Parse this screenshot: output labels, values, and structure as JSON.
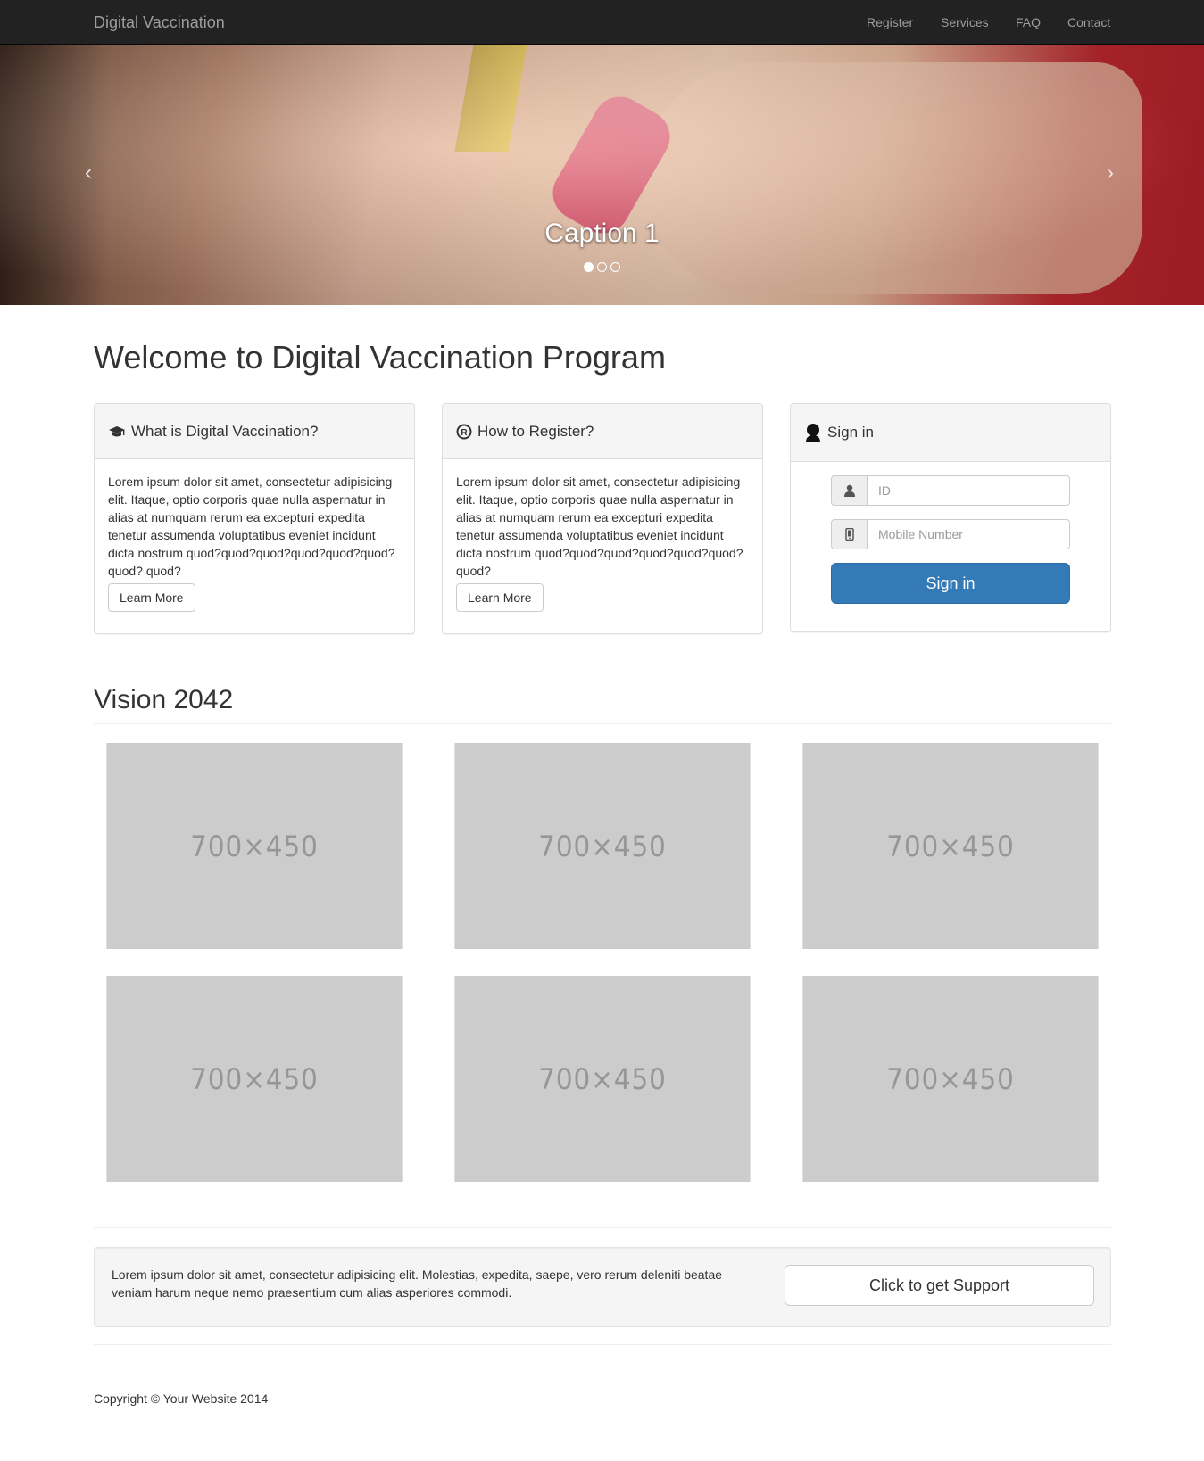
{
  "navbar": {
    "brand": "Digital Vaccination",
    "links": [
      "Register",
      "Services",
      "FAQ",
      "Contact"
    ]
  },
  "carousel": {
    "caption": "Caption 1",
    "prev_icon": "chevron-left-icon",
    "next_icon": "chevron-right-icon",
    "active_index": 0,
    "slide_count": 3
  },
  "main": {
    "title": "Welcome to Digital Vaccination Program",
    "panels": [
      {
        "icon": "graduation-cap-icon",
        "heading": "What is Digital Vaccination?",
        "text": "Lorem ipsum dolor sit amet, consectetur adipisicing elit. Itaque, optio corporis quae nulla aspernatur in alias at numquam rerum ea excepturi expedita tenetur assumenda voluptatibus eveniet incidunt dicta nostrum quod?quod?quod?quod?quod?quod?quod? quod?",
        "button": "Learn More"
      },
      {
        "icon": "registered-icon",
        "heading": "How to Register?",
        "text": "Lorem ipsum dolor sit amet, consectetur adipisicing elit. Itaque, optio corporis quae nulla aspernatur in alias at numquam rerum ea excepturi expedita tenetur assumenda voluptatibus eveniet incidunt dicta nostrum quod?quod?quod?quod?quod?quod?quod?",
        "button": "Learn More"
      }
    ],
    "signin": {
      "icon": "user-silhouette-icon",
      "heading": "Sign in",
      "id_icon": "user-icon",
      "id_placeholder": "ID",
      "mobile_icon": "phone-icon",
      "mobile_placeholder": "Mobile Number",
      "button": "Sign in"
    }
  },
  "vision": {
    "title": "Vision 2042",
    "thumbnails": [
      "700×450",
      "700×450",
      "700×450",
      "700×450",
      "700×450",
      "700×450"
    ]
  },
  "cta": {
    "text": "Lorem ipsum dolor sit amet, consectetur adipisicing elit. Molestias, expedita, saepe, vero rerum deleniti beatae veniam harum neque nemo praesentium cum alias asperiores commodi.",
    "button": "Click to get Support"
  },
  "footer": {
    "copyright": "Copyright © Your Website 2014"
  },
  "colors": {
    "navbar_bg": "#222222",
    "primary": "#337ab7",
    "placeholder_bg": "#cccccc"
  }
}
